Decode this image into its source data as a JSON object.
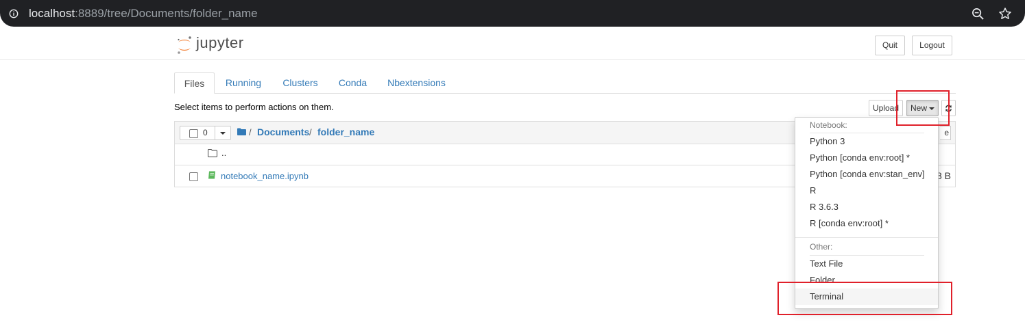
{
  "browser": {
    "url_host": "localhost",
    "url_rest": ":8889/tree/Documents/folder_name",
    "info_icon": "info-icon",
    "zoom_icon": "zoom-out-icon",
    "star_icon": "bookmark-star-icon"
  },
  "header": {
    "logo_text": "jupyter",
    "quit_label": "Quit",
    "logout_label": "Logout"
  },
  "tabs": [
    {
      "label": "Files",
      "active": true
    },
    {
      "label": "Running"
    },
    {
      "label": "Clusters"
    },
    {
      "label": "Conda"
    },
    {
      "label": "Nbextensions"
    }
  ],
  "toolbar": {
    "hint": "Select items to perform actions on them.",
    "upload_label": "Upload",
    "new_label": "New",
    "delete_partial": "e"
  },
  "file_list": {
    "selected_count": "0",
    "breadcrumb": [
      "Documents",
      "folder_name"
    ],
    "breadcrumb_sep": "/",
    "rows": [
      {
        "name": "..",
        "type": "folder"
      },
      {
        "name": "notebook_name.ipynb",
        "type": "notebook",
        "size": "8 B"
      }
    ]
  },
  "new_menu": {
    "notebook_header": "Notebook:",
    "notebook_items": [
      "Python 3",
      "Python [conda env:root] *",
      "Python [conda env:stan_env]",
      "R",
      "R 3.6.3",
      "R [conda env:root] *"
    ],
    "other_header": "Other:",
    "other_items": [
      "Text File",
      "Folder",
      "Terminal"
    ],
    "highlighted_item": "Terminal"
  },
  "colors": {
    "link": "#337ab7",
    "annotation_red": "#e0202a",
    "jupyter_orange": "#f37726"
  }
}
